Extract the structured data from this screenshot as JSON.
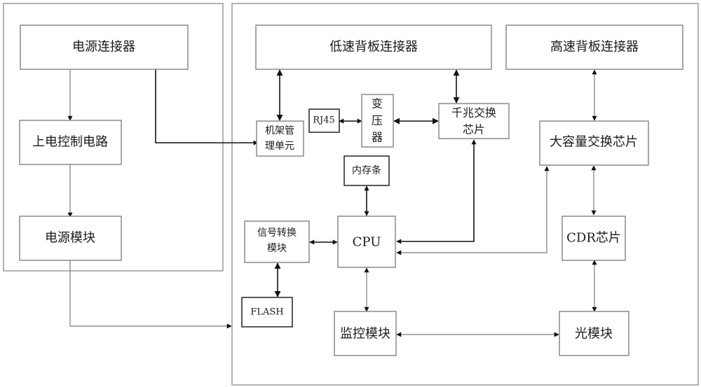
{
  "diagram": {
    "groups": [
      {
        "id": "power_board",
        "label": ""
      },
      {
        "id": "main_board",
        "label": ""
      }
    ],
    "nodes": {
      "power_connector": "电源连接器",
      "power_on_ctrl": "上电控制电路",
      "power_module": "电源模块",
      "low_speed_backplane": "低速背板连接器",
      "high_speed_backplane": "高速背板连接器",
      "rack_mgmt": "机架管理单元",
      "rack_mgmt_line1": "机架管",
      "rack_mgmt_line2": "理单元",
      "rj45": "RJ45",
      "transformer": "变压器",
      "transformer_c1": "变",
      "transformer_c2": "压",
      "transformer_c3": "器",
      "gbe_switch": "千兆交换芯片",
      "gbe_switch_line1": "千兆交换",
      "gbe_switch_line2": "芯片",
      "large_switch": "大容量交换芯片",
      "memory": "内存条",
      "signal_conv": "信号转换模块",
      "signal_conv_line1": "信号转换",
      "signal_conv_line2": "模块",
      "cpu": "CPU",
      "cdr": "CDR芯片",
      "flash": "FLASH",
      "monitor": "监控模块",
      "optical": "光模块"
    },
    "edges": [
      {
        "from": "power_connector",
        "to": "power_on_ctrl",
        "type": "one-way"
      },
      {
        "from": "power_on_ctrl",
        "to": "power_module",
        "type": "one-way"
      },
      {
        "from": "power_connector",
        "to": "rack_mgmt",
        "type": "one-way"
      },
      {
        "from": "power_module",
        "to": "main_board",
        "type": "one-way"
      },
      {
        "from": "low_speed_backplane",
        "to": "rack_mgmt",
        "type": "bidirectional"
      },
      {
        "from": "low_speed_backplane",
        "to": "gbe_switch",
        "type": "bidirectional"
      },
      {
        "from": "rj45",
        "to": "transformer",
        "type": "bidirectional"
      },
      {
        "from": "transformer",
        "to": "gbe_switch",
        "type": "bidirectional"
      },
      {
        "from": "high_speed_backplane",
        "to": "large_switch",
        "type": "bidirectional"
      },
      {
        "from": "memory",
        "to": "cpu",
        "type": "bidirectional"
      },
      {
        "from": "signal_conv",
        "to": "cpu",
        "type": "bidirectional"
      },
      {
        "from": "gbe_switch",
        "to": "cpu",
        "type": "bidirectional"
      },
      {
        "from": "large_switch",
        "to": "cpu",
        "type": "bidirectional"
      },
      {
        "from": "large_switch",
        "to": "cdr",
        "type": "bidirectional"
      },
      {
        "from": "signal_conv",
        "to": "flash",
        "type": "bidirectional"
      },
      {
        "from": "cpu",
        "to": "monitor",
        "type": "bidirectional"
      },
      {
        "from": "cdr",
        "to": "optical",
        "type": "bidirectional"
      },
      {
        "from": "monitor",
        "to": "optical",
        "type": "bidirectional"
      }
    ]
  }
}
